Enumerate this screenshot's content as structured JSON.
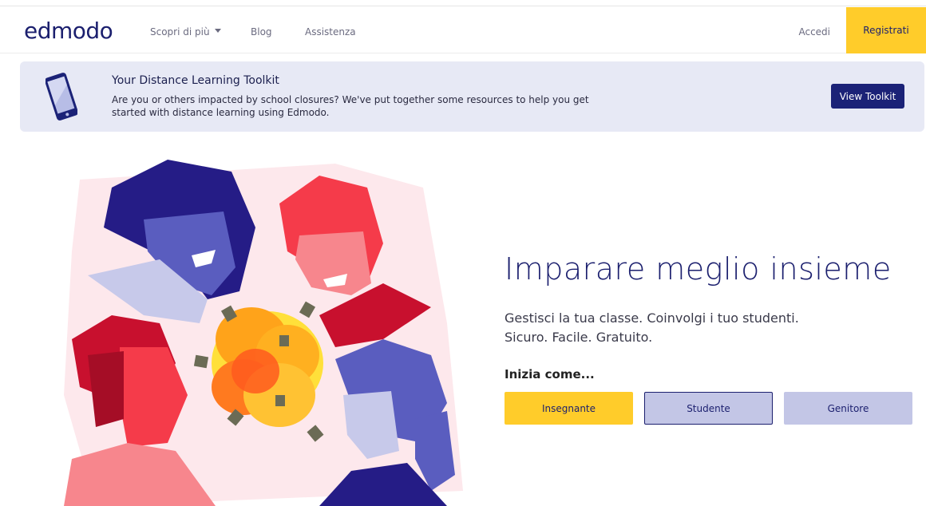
{
  "nav": {
    "logo": "edmodo",
    "discover_label": "Scopri di più",
    "blog_label": "Blog",
    "help_label": "Assistenza",
    "login_label": "Accedi",
    "register_label": "Registrati"
  },
  "banner": {
    "title": "Your Distance Learning Toolkit",
    "text": "Are you or others impacted by school closures? We've put together some resources to help you get started with distance learning using Edmodo.",
    "button_label": "View Toolkit"
  },
  "hero": {
    "title": "Imparare meglio insieme",
    "subtitle_line1": "Gestisci la tua classe. Coinvolgi i tuo studenti.",
    "subtitle_line2": "Sicuro. Facile. Gratuito.",
    "start_as": "Inizia come...",
    "roles": {
      "teacher": "Insegnante",
      "student": "Studente",
      "parent": "Genitore"
    }
  },
  "colors": {
    "brand_navy": "#1b1f6e",
    "accent_yellow": "#ffcc2a",
    "lavender": "#c3c6e6",
    "banner_bg": "#e7e9f5"
  }
}
